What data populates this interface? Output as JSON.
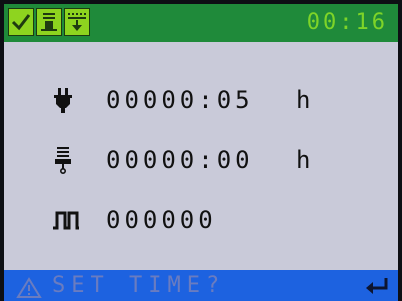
{
  "topbar": {
    "icons": [
      "checkmark-icon",
      "punch-icon",
      "download-icon"
    ],
    "time": "00:16"
  },
  "rows": [
    {
      "icon": "plug-icon",
      "value": "00000:05",
      "unit": "h"
    },
    {
      "icon": "service-icon",
      "value": "00000:00",
      "unit": "h"
    },
    {
      "icon": "pulse-icon",
      "value": "000000",
      "unit": ""
    }
  ],
  "status": {
    "message": "SET TIME?",
    "warning_icon": "warning-icon",
    "enter_icon": "enter-icon"
  },
  "colors": {
    "screen_bg": "#c9cad9",
    "topbar_bg": "#1f8a3a",
    "icon_bg": "#8ed41f",
    "time_text": "#7ed428",
    "status_bg": "#1d62e0",
    "status_text": "#6a7cc0"
  }
}
